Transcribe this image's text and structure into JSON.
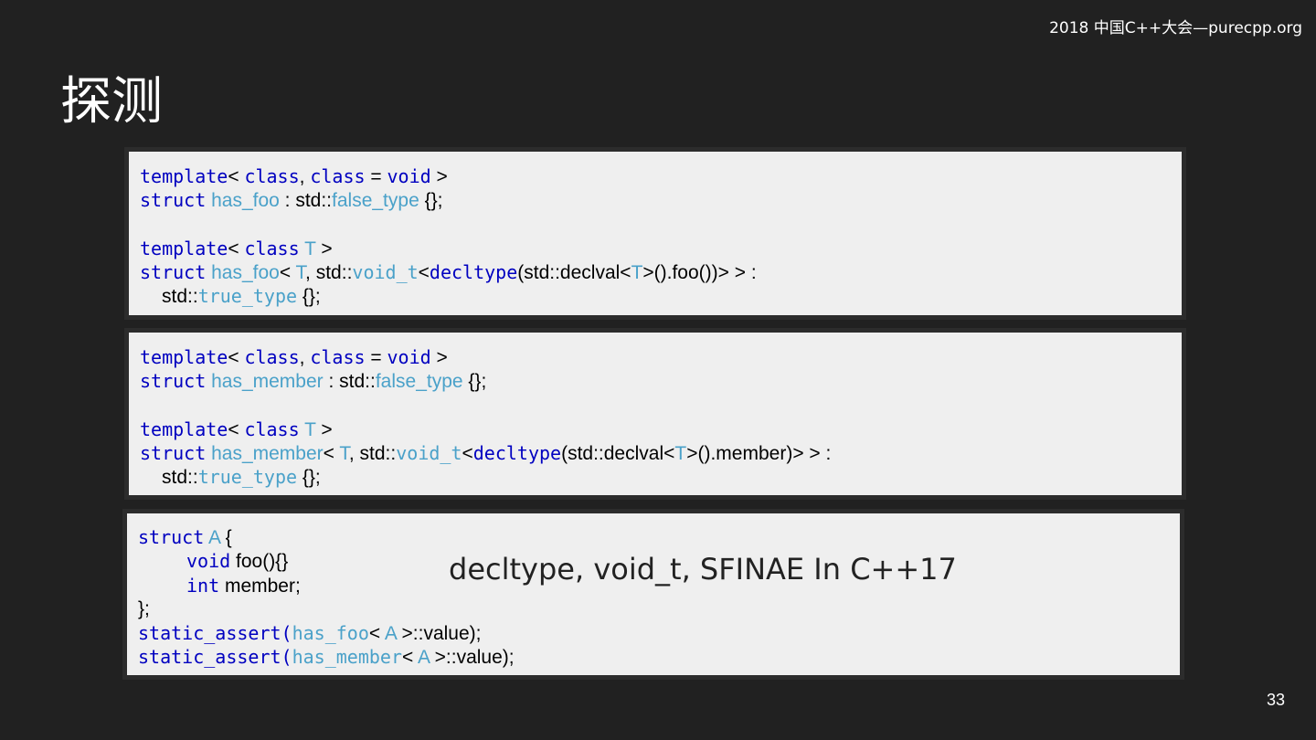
{
  "header": {
    "event": "2018 中国C++大会—purecpp.org"
  },
  "slide": {
    "title": "探测",
    "page_number": "33"
  },
  "box1": {
    "l1": {
      "a": "template",
      "b": "< ",
      "c": "class",
      "d": ", ",
      "e": "class",
      "f": " = ",
      "g": "void",
      "h": " >"
    },
    "l2": {
      "a": "struct",
      "b": " ",
      "c": "has_foo",
      "d": " : std::",
      "e": "false_type",
      "f": " {};"
    },
    "l4": {
      "a": "template",
      "b": "< ",
      "c": "class",
      "d": " ",
      "e": "T",
      "f": " >"
    },
    "l5": {
      "a": "struct",
      "b": " ",
      "c": "has_foo",
      "d": "< ",
      "e": "T",
      "f": ", std::",
      "g": "void_t",
      "h": "<",
      "i": "decltype",
      "j": "(std::declval<",
      "k": "T",
      "l": ">().foo())> > :"
    },
    "l6": {
      "a": "std::",
      "b": "true_type",
      "c": " {};"
    }
  },
  "box2": {
    "l1": {
      "a": "template",
      "b": "< ",
      "c": "class",
      "d": ", ",
      "e": "class",
      "f": " = ",
      "g": "void",
      "h": " >"
    },
    "l2": {
      "a": "struct",
      "b": " ",
      "c": "has_member",
      "d": " : std::",
      "e": "false_type",
      "f": " {};"
    },
    "l4": {
      "a": "template",
      "b": "< ",
      "c": "class",
      "d": " ",
      "e": "T",
      "f": " >"
    },
    "l5": {
      "a": "struct",
      "b": " ",
      "c": "has_member",
      "d": "< ",
      "e": "T",
      "f": ", std::",
      "g": "void_t",
      "h": "<",
      "i": "decltype",
      "j": "(std::declval<",
      "k": "T",
      "l": ">().member)> > :"
    },
    "l6": {
      "a": "std::",
      "b": "true_type",
      "c": " {};"
    }
  },
  "box3": {
    "l1": {
      "a": "struct",
      "b": " ",
      "c": "A",
      "d": " {"
    },
    "l2": {
      "a": "void",
      "b": " foo(){}"
    },
    "l3": {
      "a": "int",
      "b": " member;"
    },
    "l4": {
      "a": "};"
    },
    "l5": {
      "a": "static_assert(",
      "b": "has_foo",
      "c": "< ",
      "d": "A",
      "e": " >::value);"
    },
    "l6": {
      "a": "static_assert(",
      "b": "has_member",
      "c": "< ",
      "d": "A",
      "e": " >::value);"
    },
    "caption": "decltype, void_t, SFINAE In C++17"
  },
  "colors": {
    "keyword": "#0000c0",
    "type": "#4aa1c9",
    "background": "#212121",
    "code_bg": "#efefef"
  }
}
